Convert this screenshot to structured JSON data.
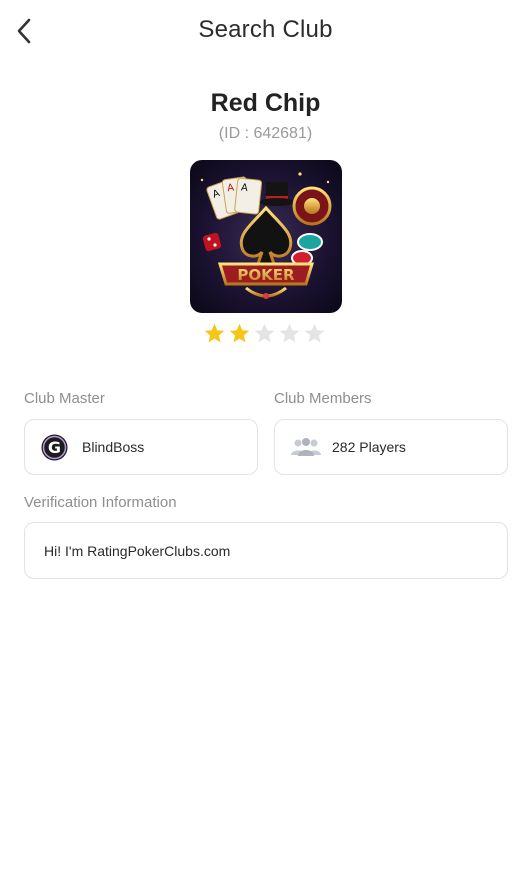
{
  "header": {
    "title": "Search Club",
    "back_icon": "chevron-left-icon"
  },
  "club": {
    "name": "Red Chip",
    "id_text": "(ID : 642681)",
    "logo_text": "POKER",
    "rating": 2,
    "rating_max": 5,
    "star_color": "#F5C518",
    "star_empty_color": "#E4E4E4"
  },
  "master": {
    "label": "Club Master",
    "name": "BlindBoss",
    "avatar_letter": "G"
  },
  "members": {
    "label": "Club Members",
    "count_text": "282 Players",
    "icon": "group-icon"
  },
  "verification": {
    "label": "Verification Information",
    "text": "Hi! I'm RatingPokerClubs.com"
  }
}
